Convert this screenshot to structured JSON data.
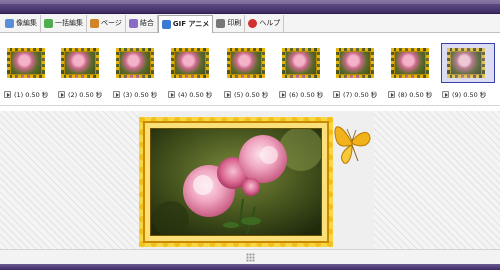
{
  "menu": {
    "items": [
      {
        "label": "像編集",
        "icon": "image-edit-icon",
        "color": "#5a8fd8"
      },
      {
        "label": "一括編集",
        "icon": "batch-edit-icon",
        "color": "#4fae4f"
      },
      {
        "label": "ページ",
        "icon": "page-icon",
        "color": "#d2842a"
      },
      {
        "label": "結合",
        "icon": "merge-icon",
        "color": "#8a6cc8"
      },
      {
        "label": "GIF アニメ",
        "icon": "gif-animation-icon",
        "color": "#3a7ad0"
      },
      {
        "label": "印刷",
        "icon": "print-icon",
        "color": "#777777"
      },
      {
        "label": "ヘルプ",
        "icon": "help-icon",
        "color": "#d23030"
      }
    ],
    "active_index": 4
  },
  "frames": [
    {
      "label": "(1) 0.50 秒"
    },
    {
      "label": "(2) 0.50 秒"
    },
    {
      "label": "(3) 0.50 秒"
    },
    {
      "label": "(4) 0.50 秒"
    },
    {
      "label": "(5) 0.50 秒"
    },
    {
      "label": "(6) 0.50 秒"
    },
    {
      "label": "(7) 0.50 秒"
    },
    {
      "label": "(8) 0.50 秒"
    },
    {
      "label": "(9) 0.50 秒"
    }
  ],
  "selected_frame": 9,
  "colors": {
    "title_bar": "#4a3876",
    "frame_border": "#e7b40f",
    "selection": "#3b3fa8",
    "butterfly": "#f2b21c"
  }
}
